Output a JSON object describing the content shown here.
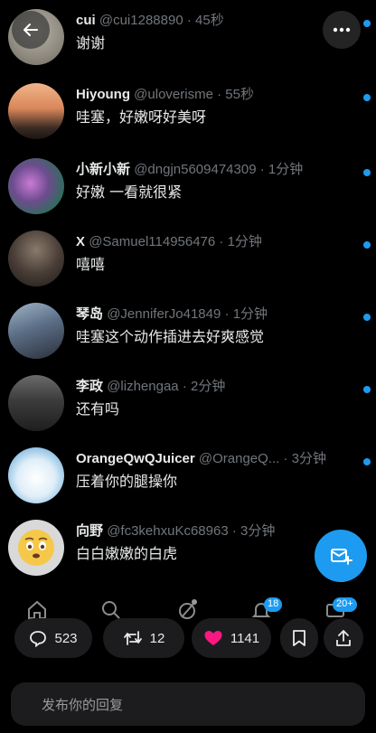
{
  "replies": [
    {
      "username": "cui",
      "handle": "@cui1288890",
      "time": "45秒",
      "text": "谢谢",
      "avatar_color": "#9a9588"
    },
    {
      "username": "Hiyoung",
      "handle": "@uloverisme",
      "time": "55秒",
      "text": "哇塞，好嫩呀好美呀",
      "avatar_color": "#c98a5e"
    },
    {
      "username": "小新小新",
      "handle": "@dngjn5609474309",
      "time": "1分钟",
      "text": "好嫩 一看就很紧",
      "avatar_color": "#6e4d7a"
    },
    {
      "username": "X",
      "handle": "@Samuel114956476",
      "time": "1分钟",
      "text": "嘻嘻",
      "avatar_color": "#4a3f38"
    },
    {
      "username": "琴岛",
      "handle": "@JenniferJo41849",
      "time": "1分钟",
      "text": "哇塞这个动作插进去好爽感觉",
      "avatar_color": "#5b6e86"
    },
    {
      "username": "李政",
      "handle": "@lizhengaa",
      "time": "2分钟",
      "text": "还有吗",
      "avatar_color": "#3c3c3c"
    },
    {
      "username": "OrangeQwQJuicer",
      "handle": "@OrangeQ...",
      "time": "3分钟",
      "text": "压着你的腿操你",
      "avatar_color": "#dfeef8"
    },
    {
      "username": "向野",
      "handle": "@fc3kehxuKc68963",
      "time": "3分钟",
      "text": "白白嫩嫩的白虎",
      "avatar_color": "#d9d9d9"
    }
  ],
  "separator": "·",
  "nav": {
    "items": [
      "home-icon",
      "search-icon",
      "grok-icon",
      "notifications-icon",
      "messages-icon"
    ],
    "notifications_badge": "18",
    "messages_badge": "20+"
  },
  "actions": {
    "reply_count": "523",
    "retweet_count": "12",
    "like_count": "1141"
  },
  "reply_bar": {
    "placeholder": "发布你的回复"
  },
  "colors": {
    "accent": "#1d9bf0",
    "like": "#f91880",
    "background": "#000000"
  }
}
